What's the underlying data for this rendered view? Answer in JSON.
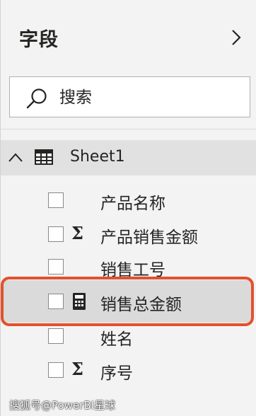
{
  "panel": {
    "title": "字段",
    "collapse_icon": "chevron-right-icon"
  },
  "search": {
    "placeholder": "搜索",
    "value": "",
    "icon": "search-icon"
  },
  "table": {
    "name": "Sheet1",
    "expanded": true,
    "icon": "table-icon"
  },
  "fields": [
    {
      "label": "产品名称",
      "type_icon": "none",
      "checked": false
    },
    {
      "label": "产品销售金额",
      "type_icon": "sigma-icon",
      "checked": false
    },
    {
      "label": "销售工号",
      "type_icon": "none",
      "checked": false
    },
    {
      "label": "销售总金额",
      "type_icon": "calculator-icon",
      "checked": false,
      "highlighted": true
    },
    {
      "label": "姓名",
      "type_icon": "none",
      "checked": false
    },
    {
      "label": "序号",
      "type_icon": "sigma-icon",
      "checked": false
    }
  ],
  "sigma_glyph": "Σ",
  "highlight_color": "#e2512c",
  "watermark": "搜狐号@PowerBI星球"
}
